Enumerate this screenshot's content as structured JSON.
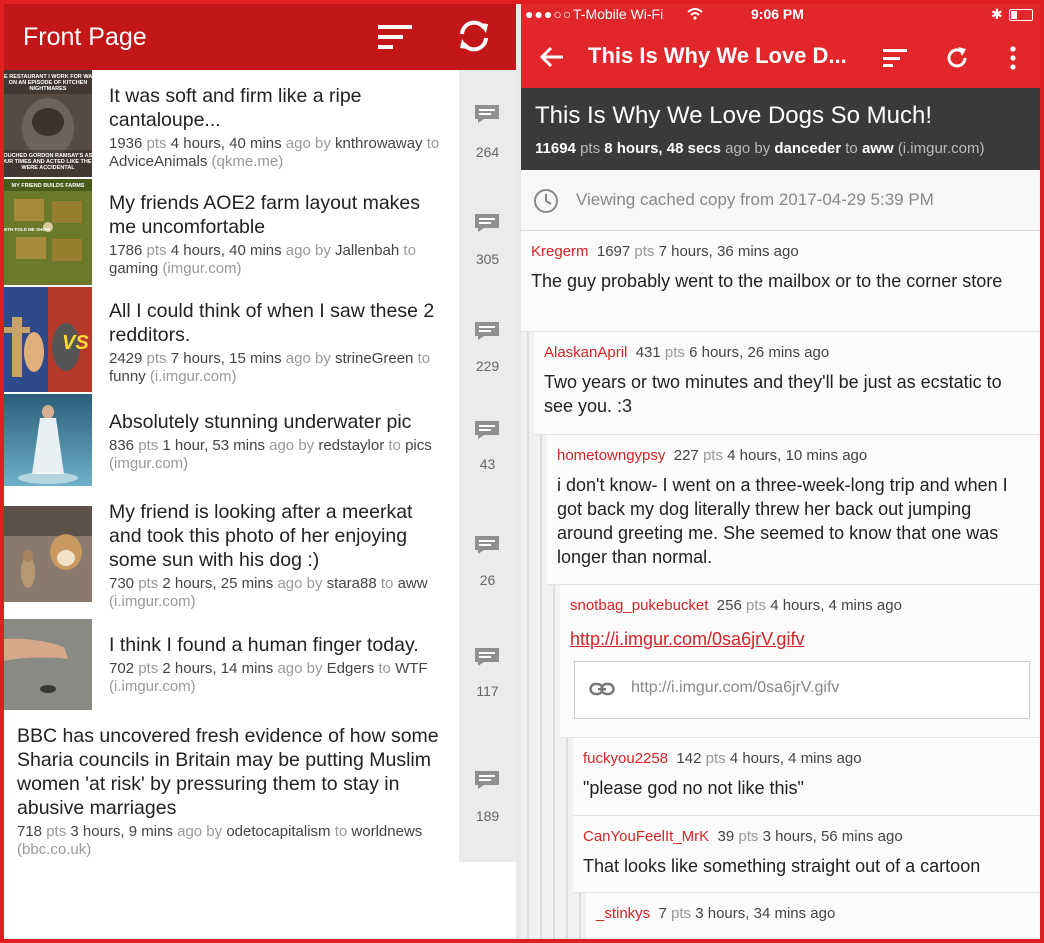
{
  "left": {
    "title": "Front Page",
    "posts": [
      {
        "title": "It was soft and firm like a ripe cantaloupe...",
        "score": "1936",
        "score_unit": "pts",
        "time": "4 hours, 40 mins",
        "ago": "ago by",
        "author": "knthrowaway",
        "to": "to",
        "subreddit": "AdviceAnimals",
        "domain": "(qkme.me)",
        "comments": "264",
        "thumb_caption": "HE RESTAURANT I WORK FOR WAS ON AN EPISODE OF KITCHEN NIGHTMARES / TOUCHED GORDON RAMSAY'S ASS OUR TIMES AND ACTED LIKE THEY WERE ACCIDENTAL"
      },
      {
        "title": "My friends AOE2 farm layout makes me uncomfortable",
        "score": "1786",
        "score_unit": "pts",
        "time": "4 hours, 40 mins",
        "ago": "ago by",
        "author": "Jallenbah",
        "to": "to",
        "subreddit": "gaming",
        "domain": "(imgur.com)",
        "comments": "305",
        "thumb_caption": "MY FRIEND BUILDS FARMS / WITH FOLD ME SHOW"
      },
      {
        "title": "All I could think of when I saw these 2 redditors.",
        "score": "2429",
        "score_unit": "pts",
        "time": "7 hours, 15 mins",
        "ago": "ago by",
        "author": "strineGreen",
        "to": "to",
        "subreddit": "funny",
        "domain": "(i.imgur.com)",
        "comments": "229",
        "thumb_caption": "VS"
      },
      {
        "title": "Absolutely stunning underwater pic",
        "score": "836",
        "score_unit": "pts",
        "time": "1 hour, 53 mins",
        "ago": "ago by",
        "author": "redstaylor",
        "to": "to",
        "subreddit": "pics",
        "domain": "(imgur.com)",
        "comments": "43"
      },
      {
        "title": "My friend is looking after a meerkat and took this photo of her enjoying some sun with his dog :)",
        "score": "730",
        "score_unit": "pts",
        "time": "2 hours, 25 mins",
        "ago": "ago by",
        "author": "stara88",
        "to": "to",
        "subreddit": "aww",
        "domain": "(i.imgur.com)",
        "comments": "26"
      },
      {
        "title": "I think I found a human finger today.",
        "score": "702",
        "score_unit": "pts",
        "time": "2 hours, 14 mins",
        "ago": "ago by",
        "author": "Edgers",
        "to": "to",
        "subreddit": "WTF",
        "domain": "(i.imgur.com)",
        "comments": "117"
      },
      {
        "title": "BBC has uncovered fresh evidence of how some Sharia councils in Britain may be putting Muslim women 'at risk' by pressuring them to stay in abusive marriages",
        "score": "718",
        "score_unit": "pts",
        "time": "3 hours, 9 mins",
        "ago": "ago by",
        "author": "odetocapitalism",
        "to": "to",
        "subreddit": "worldnews",
        "domain": "(bbc.co.uk)",
        "comments": "189"
      }
    ]
  },
  "right": {
    "status": {
      "carrier": "T-Mobile Wi-Fi",
      "time": "9:06 PM"
    },
    "appbar_title": "This Is Why We Love D...",
    "post": {
      "title": "This Is Why We Love Dogs So Much!",
      "score": "11694",
      "score_unit": "pts",
      "time": "8 hours, 48 secs",
      "ago": "ago by",
      "author": "danceder",
      "to": "to",
      "subreddit": "aww",
      "domain": "(i.imgur.com)"
    },
    "cached_text": "Viewing cached copy from 2017-04-29 5:39 PM",
    "comments": [
      {
        "user": "Kregerm",
        "score": "1697",
        "unit": "pts",
        "time": "7 hours, 36 mins ago",
        "body": "The guy probably went to the mailbox or to the corner store"
      },
      {
        "user": "AlaskanApril",
        "score": "431",
        "unit": "pts",
        "time": "6 hours, 26 mins ago",
        "body": "Two years or two minutes and they'll be just as ecstatic to see you. :3"
      },
      {
        "user": "hometowngypsy",
        "score": "227",
        "unit": "pts",
        "time": "4 hours, 10 mins ago",
        "body": "i don't know- I went on a three-week-long trip and when I got back my dog literally threw her back out jumping around greeting me. She seemed to know that one was longer than normal."
      },
      {
        "user": "snotbag_pukebucket",
        "score": "256",
        "unit": "pts",
        "time": "4 hours, 4 mins ago",
        "link": "http://i.imgur.com/0sa6jrV.gifv",
        "link_preview": "http://i.imgur.com/0sa6jrV.gifv"
      },
      {
        "user": "fuckyou2258",
        "score": "142",
        "unit": "pts",
        "time": "4 hours, 4 mins ago",
        "body": "\"please god no not like this\""
      },
      {
        "user": "CanYouFeelIt_MrK",
        "score": "39",
        "unit": "pts",
        "time": "3 hours, 56 mins ago",
        "body": "That looks like something straight out of a cartoon"
      },
      {
        "user": "_stinkys",
        "score": "7",
        "unit": "pts",
        "time": "3 hours, 34 mins ago",
        "body": ""
      }
    ]
  },
  "colors": {
    "left_header": "#c21618",
    "right_header": "#e2272a",
    "username": "#d42426",
    "frame": "#e02020"
  }
}
